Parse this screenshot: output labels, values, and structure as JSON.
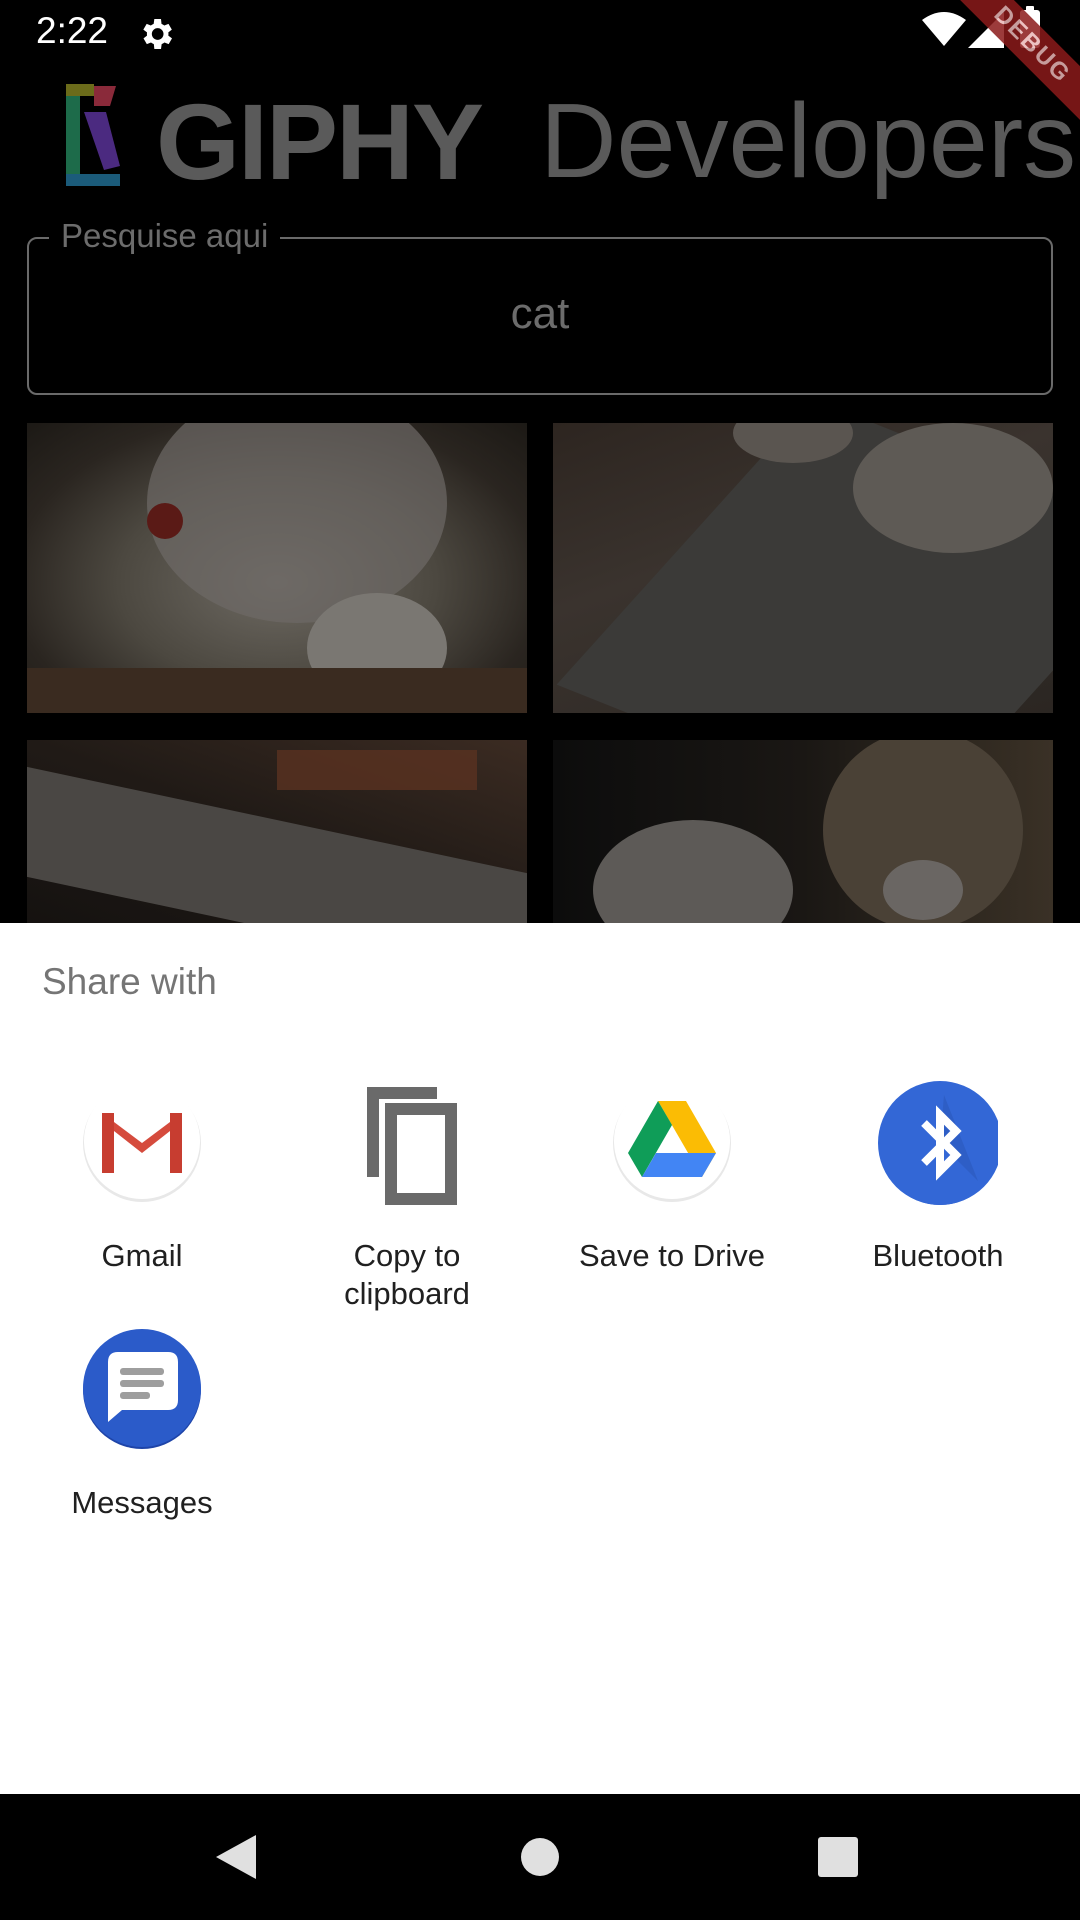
{
  "status_bar": {
    "time": "2:22",
    "debug_banner": "DEBUG"
  },
  "app": {
    "logo_word": "GIPHY",
    "logo_sub": "Developers",
    "search": {
      "label": "Pesquise aqui",
      "value": "cat"
    }
  },
  "share_sheet": {
    "title": "Share with",
    "items": [
      {
        "label": "Gmail",
        "icon": "gmail-icon"
      },
      {
        "label": "Copy to\nclipboard",
        "icon": "copy-icon"
      },
      {
        "label": "Save to Drive",
        "icon": "drive-icon"
      },
      {
        "label": "Bluetooth",
        "icon": "bluetooth-icon"
      },
      {
        "label": "Messages",
        "icon": "messages-icon"
      }
    ]
  },
  "nav_bar": {
    "buttons": [
      "back",
      "home",
      "recents"
    ]
  },
  "colors": {
    "scrim": "#000000",
    "sheet_background": "#ffffff",
    "bluetooth_blue": "#3367d6",
    "messages_blue": "#2b5bc9",
    "gmail_red": "#d54b3d"
  }
}
